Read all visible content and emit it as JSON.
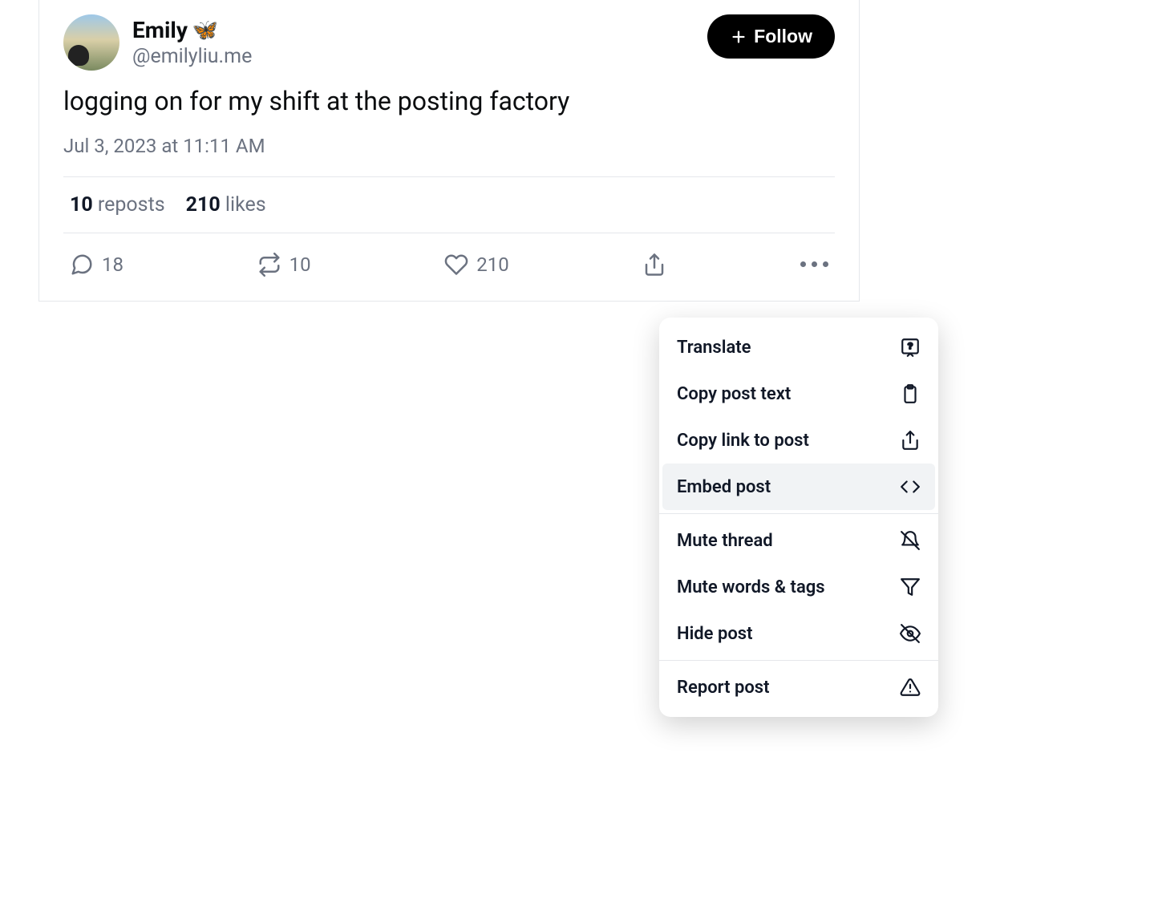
{
  "post": {
    "author": {
      "display_name": "Emily",
      "emoji": "🦋",
      "handle": "@emilyliu.me"
    },
    "follow_label": "Follow",
    "body": "logging on for my shift at the posting factory",
    "timestamp": "Jul 3, 2023 at 11:11 AM",
    "stats": {
      "reposts_count": "10",
      "reposts_label": "reposts",
      "likes_count": "210",
      "likes_label": "likes"
    },
    "actions": {
      "reply_count": "18",
      "repost_count": "10",
      "like_count": "210"
    }
  },
  "menu": {
    "translate": "Translate",
    "copy_text": "Copy post text",
    "copy_link": "Copy link to post",
    "embed": "Embed post",
    "mute_thread": "Mute thread",
    "mute_words": "Mute words & tags",
    "hide": "Hide post",
    "report": "Report post"
  }
}
